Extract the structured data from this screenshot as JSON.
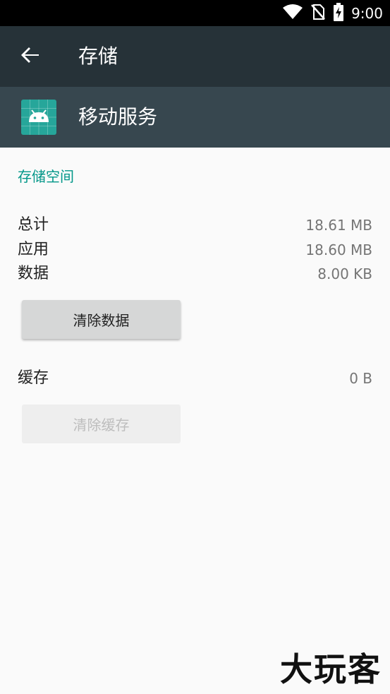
{
  "status_bar": {
    "time": "9:00",
    "icons": [
      "wifi-icon",
      "no-sim-icon",
      "battery-charging-icon"
    ]
  },
  "toolbar": {
    "title": "存储",
    "back_icon": "arrow-back-icon"
  },
  "app": {
    "name": "移动服务",
    "icon": "android-icon",
    "icon_color": "#26a69a"
  },
  "storage": {
    "section_title": "存储空间",
    "total_label": "总计",
    "total_value": "18.61 MB",
    "app_label": "应用",
    "app_value": "18.60 MB",
    "data_label": "数据",
    "data_value": "8.00 KB",
    "clear_data_label": "清除数据",
    "cache_label": "缓存",
    "cache_value": "0 B",
    "clear_cache_label": "清除缓存"
  },
  "watermark": "大玩客",
  "colors": {
    "toolbar": "#263238",
    "app_header": "#37474f",
    "accent": "#009688"
  }
}
